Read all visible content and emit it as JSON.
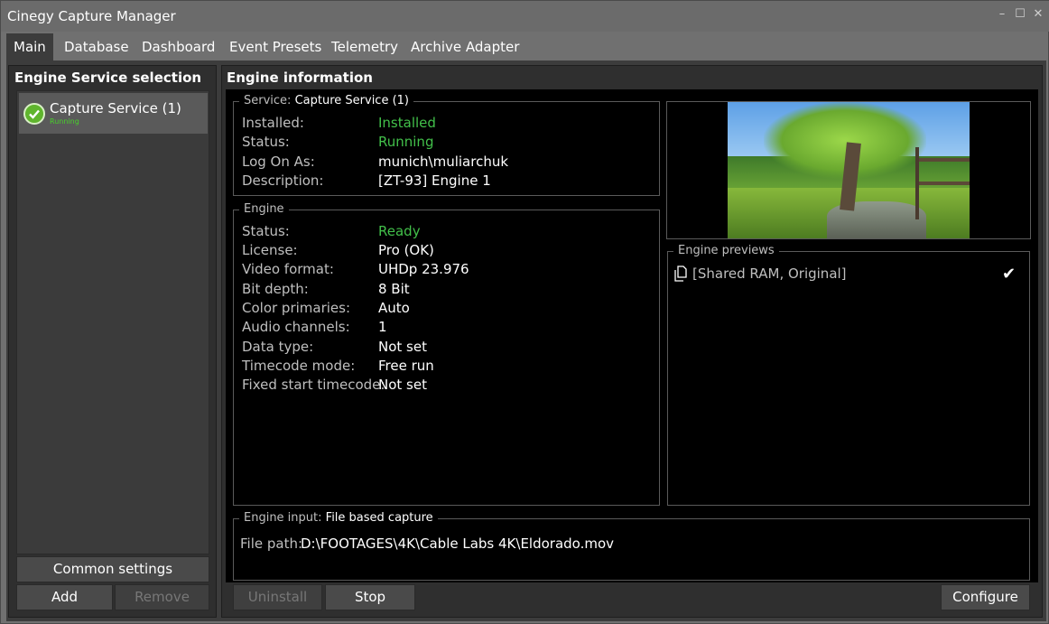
{
  "window": {
    "title": "Cinegy Capture Manager"
  },
  "titlebar_controls": {
    "minimize": "–",
    "maximize": "☐",
    "close": "✕"
  },
  "tabs": [
    {
      "label": "Main"
    },
    {
      "label": "Database"
    },
    {
      "label": "Dashboard"
    },
    {
      "label": "Event Presets"
    },
    {
      "label": "Telemetry"
    },
    {
      "label": "Archive Adapter"
    }
  ],
  "left_panel": {
    "title": "Engine Service selection",
    "service": {
      "name": "Capture Service (1)",
      "status": "Running"
    },
    "buttons": {
      "common_settings": "Common settings",
      "add": "Add",
      "remove": "Remove"
    }
  },
  "engine_info": {
    "title": "Engine information",
    "service_group": {
      "label": "Service:",
      "value": "Capture Service (1)",
      "rows": [
        {
          "label": "Installed:",
          "value": "Installed"
        },
        {
          "label": "Status:",
          "value": "Running"
        },
        {
          "label": "Log On As:",
          "value": "munich\\muliarchuk"
        },
        {
          "label": "Description:",
          "value": "[ZT-93] Engine 1"
        }
      ]
    },
    "engine_group": {
      "label": "Engine",
      "rows": [
        {
          "label": "Status:",
          "value": "Ready"
        },
        {
          "label": "License:",
          "value": "Pro (OK)"
        },
        {
          "label": "Video format:",
          "value": "UHDp 23.976"
        },
        {
          "label": "Bit depth:",
          "value": "8 Bit"
        },
        {
          "label": "Color primaries:",
          "value": "Auto"
        },
        {
          "label": "Audio channels:",
          "value": "1"
        },
        {
          "label": "Data type:",
          "value": "Not set"
        },
        {
          "label": "Timecode mode:",
          "value": "Free run"
        },
        {
          "label": "Fixed start timecode:",
          "value": "Not set"
        }
      ]
    },
    "previews_group": {
      "label": "Engine previews",
      "items": [
        {
          "label": "[Shared RAM, Original]",
          "checked": true
        }
      ]
    },
    "input_group": {
      "label": "Engine input:",
      "value": "File based capture",
      "file_path_label": "File path:",
      "file_path": "D:\\FOOTAGES\\4K\\Cable Labs 4K\\Eldorado.mov"
    },
    "buttons": {
      "uninstall": "Uninstall",
      "stop": "Stop",
      "configure": "Configure"
    }
  },
  "colors": {
    "accent_green": "#42c04a",
    "background": "#000000",
    "panel": "#2f2f2f"
  }
}
